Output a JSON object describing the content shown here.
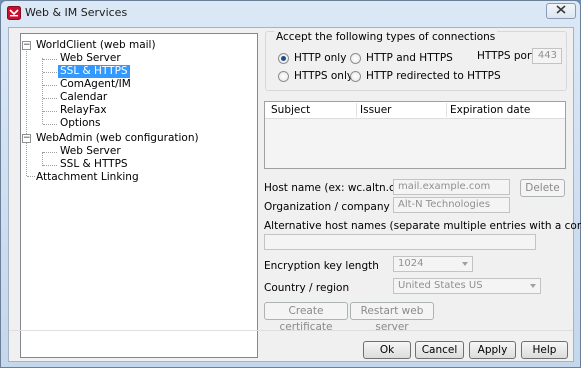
{
  "window": {
    "title": "Web & IM Services"
  },
  "tree": {
    "items": [
      {
        "label": "WorldClient (web mail)"
      },
      {
        "label": "Web Server"
      },
      {
        "label": "SSL & HTTPS"
      },
      {
        "label": "ComAgent/IM"
      },
      {
        "label": "Calendar"
      },
      {
        "label": "RelayFax"
      },
      {
        "label": "Options"
      },
      {
        "label": "WebAdmin (web configuration)"
      },
      {
        "label": "Web Server"
      },
      {
        "label": "SSL & HTTPS"
      },
      {
        "label": "Attachment Linking"
      }
    ]
  },
  "connections": {
    "caption": "Accept the following types of connections",
    "options": [
      {
        "label": "HTTP only",
        "checked": true
      },
      {
        "label": "HTTPS only",
        "checked": false
      },
      {
        "label": "HTTP and HTTPS",
        "checked": false
      },
      {
        "label": "HTTP redirected to HTTPS",
        "checked": false
      }
    ],
    "https_port_label": "HTTPS port",
    "https_port_value": "443"
  },
  "certificates": {
    "columns": [
      "Subject",
      "Issuer",
      "Expiration date"
    ]
  },
  "form": {
    "host_name_label": "Host name (ex: wc.altn.com)",
    "host_name_value": "mail.example.com",
    "delete_label": "Delete",
    "organization_label": "Organization / company name",
    "organization_value": "Alt-N Technologies",
    "alt_host_label": "Alternative host names (separate multiple entries with a comma)",
    "alt_host_value": "",
    "key_length_label": "Encryption key length",
    "key_length_value": "1024",
    "country_label": "Country / region",
    "country_value": "United States US",
    "create_cert_label": "Create certificate",
    "restart_label": "Restart web server"
  },
  "footer": {
    "ok": "Ok",
    "cancel": "Cancel",
    "apply": "Apply",
    "help": "Help"
  },
  "colors": {
    "selection": "#3399ff",
    "radio_dot": "#1e4e8a"
  }
}
